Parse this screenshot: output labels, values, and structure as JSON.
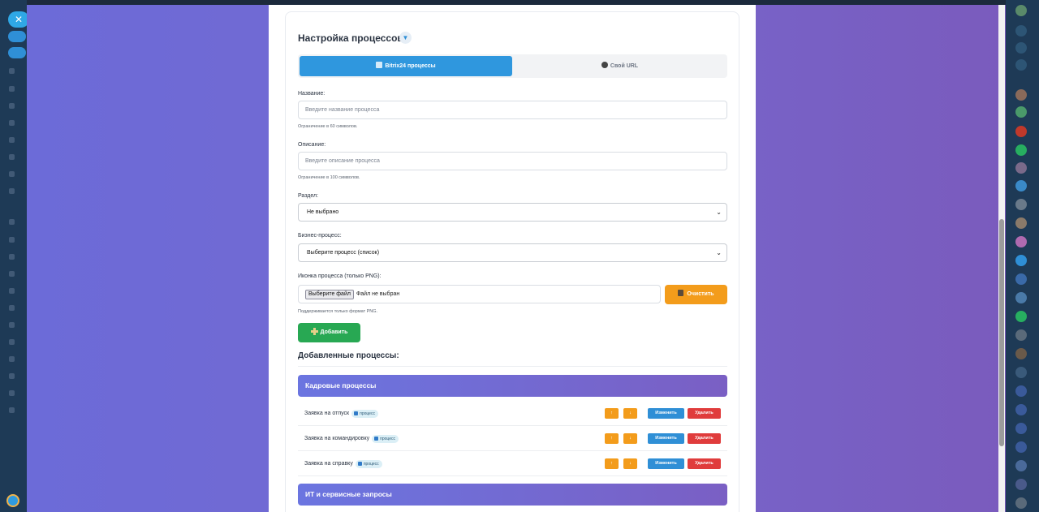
{
  "settings": {
    "title": "Настройка процессов",
    "toggle_glyph": "▼",
    "tabs": [
      {
        "label": "Bitrix24 процессы",
        "icon": "refresh-icon",
        "active": true
      },
      {
        "label": "Свой URL",
        "icon": "link-icon",
        "active": false
      }
    ]
  },
  "form": {
    "name_label": "Название:",
    "name_placeholder": "Введите название процесса",
    "name_hint": "Ограничение в 60 символов.",
    "desc_label": "Описание:",
    "desc_placeholder": "Введите описание процесса",
    "desc_hint": "Ограничение в 100 символов.",
    "section_label": "Раздел:",
    "section_value": "Не выбрано",
    "bp_label": "Бизнес-процесс:",
    "bp_value": "Выберите процесс (список)",
    "icon_label": "Иконка процесса (только PNG):",
    "file_button": "Выберите файл",
    "file_status": "Файл не выбран",
    "clear_button": "Очистить",
    "file_hint": "Поддерживается только формат PNG.",
    "add_button": "Добавить",
    "chevron": "⌄"
  },
  "added": {
    "title": "Добавленные процессы:",
    "groups": [
      {
        "name": "Кадровые процессы",
        "items": [
          {
            "name": "Заявка на отпуск",
            "badge": "процесс"
          },
          {
            "name": "Заявка на командировку",
            "badge": "процесс"
          },
          {
            "name": "Заявка на справку",
            "badge": "процесс"
          }
        ]
      },
      {
        "name": "ИТ и сервисные запросы",
        "items": []
      }
    ],
    "actions": {
      "up": "↑",
      "down": "↓",
      "edit": "Изменить",
      "delete": "Удалить"
    }
  },
  "colors": {
    "accent": "#2f97de",
    "add": "#28a853",
    "clear": "#f39c1b",
    "delete": "#e03c3c",
    "group_gradient_start": "#6b75e0",
    "group_gradient_end": "#7a5fc4"
  }
}
